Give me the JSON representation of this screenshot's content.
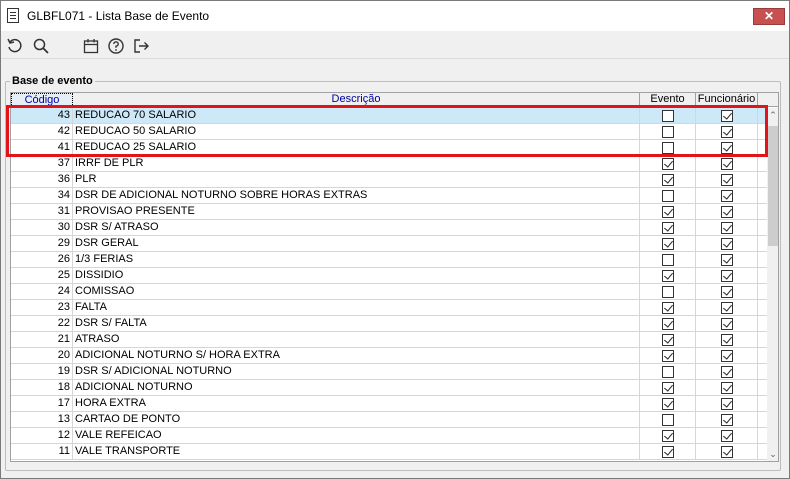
{
  "window": {
    "title": "GLBFL071 - Lista Base de Evento",
    "close_label": "✕"
  },
  "toolbar": {
    "buttons": [
      {
        "icon": "refresh-icon"
      },
      {
        "icon": "search-icon"
      },
      {
        "icon": "calendar-icon"
      },
      {
        "icon": "help-icon"
      },
      {
        "icon": "exit-icon"
      }
    ]
  },
  "group": {
    "label": "Base de evento"
  },
  "grid": {
    "headers": {
      "codigo": "Código",
      "descricao": "Descrição",
      "evento": "Evento",
      "funcionario": "Funcionário"
    },
    "rows": [
      {
        "codigo": "43",
        "descricao": "REDUCAO 70 SALARIO",
        "evento": false,
        "funcionario": true,
        "selected": true
      },
      {
        "codigo": "42",
        "descricao": "REDUCAO 50 SALARIO",
        "evento": false,
        "funcionario": true,
        "selected": false
      },
      {
        "codigo": "41",
        "descricao": "REDUCAO 25 SALARIO",
        "evento": false,
        "funcionario": true,
        "selected": false
      },
      {
        "codigo": "37",
        "descricao": "IRRF DE PLR",
        "evento": true,
        "funcionario": true,
        "selected": false
      },
      {
        "codigo": "36",
        "descricao": "PLR",
        "evento": true,
        "funcionario": true,
        "selected": false
      },
      {
        "codigo": "34",
        "descricao": "DSR DE ADICIONAL NOTURNO SOBRE HORAS EXTRAS",
        "evento": false,
        "funcionario": true,
        "selected": false
      },
      {
        "codigo": "31",
        "descricao": "PROVISAO PRESENTE",
        "evento": true,
        "funcionario": true,
        "selected": false
      },
      {
        "codigo": "30",
        "descricao": "DSR S/ ATRASO",
        "evento": true,
        "funcionario": true,
        "selected": false
      },
      {
        "codigo": "29",
        "descricao": "DSR GERAL",
        "evento": true,
        "funcionario": true,
        "selected": false
      },
      {
        "codigo": "26",
        "descricao": "1/3 FERIAS",
        "evento": false,
        "funcionario": true,
        "selected": false
      },
      {
        "codigo": "25",
        "descricao": "DISSIDIO",
        "evento": true,
        "funcionario": true,
        "selected": false
      },
      {
        "codigo": "24",
        "descricao": "COMISSAO",
        "evento": false,
        "funcionario": true,
        "selected": false
      },
      {
        "codigo": "23",
        "descricao": "FALTA",
        "evento": true,
        "funcionario": true,
        "selected": false
      },
      {
        "codigo": "22",
        "descricao": "DSR S/ FALTA",
        "evento": true,
        "funcionario": true,
        "selected": false
      },
      {
        "codigo": "21",
        "descricao": "ATRASO",
        "evento": true,
        "funcionario": true,
        "selected": false
      },
      {
        "codigo": "20",
        "descricao": "ADICIONAL NOTURNO S/ HORA EXTRA",
        "evento": true,
        "funcionario": true,
        "selected": false
      },
      {
        "codigo": "19",
        "descricao": "DSR S/ ADICIONAL NOTURNO",
        "evento": false,
        "funcionario": true,
        "selected": false
      },
      {
        "codigo": "18",
        "descricao": "ADICIONAL NOTURNO",
        "evento": true,
        "funcionario": true,
        "selected": false
      },
      {
        "codigo": "17",
        "descricao": "HORA EXTRA",
        "evento": true,
        "funcionario": true,
        "selected": false
      },
      {
        "codigo": "13",
        "descricao": "CARTAO DE PONTO",
        "evento": false,
        "funcionario": true,
        "selected": false
      },
      {
        "codigo": "12",
        "descricao": "VALE REFEICAO",
        "evento": true,
        "funcionario": true,
        "selected": false
      },
      {
        "codigo": "11",
        "descricao": "VALE TRANSPORTE",
        "evento": true,
        "funcionario": true,
        "selected": false
      }
    ]
  },
  "colors": {
    "selection": "#cde8f6",
    "highlight_border": "#e0141a",
    "header_link": "#0000a0"
  }
}
